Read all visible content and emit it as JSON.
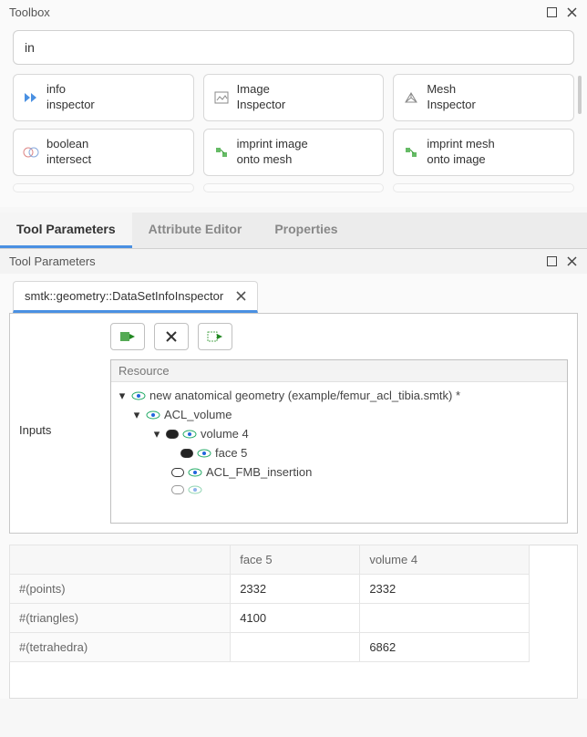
{
  "toolbox": {
    "title": "Toolbox",
    "search_value": "in",
    "items": [
      {
        "icon": "fast-forward",
        "line1": "info",
        "line2": "inspector"
      },
      {
        "icon": "image",
        "line1": "Image",
        "line2": "Inspector"
      },
      {
        "icon": "mesh",
        "line1": "Mesh",
        "line2": "Inspector"
      },
      {
        "icon": "bool",
        "line1": "boolean",
        "line2": "intersect"
      },
      {
        "icon": "imprint",
        "line1": "imprint image",
        "line2": "onto mesh"
      },
      {
        "icon": "imprint",
        "line1": "imprint mesh",
        "line2": "onto image"
      }
    ]
  },
  "tabs": {
    "items": [
      "Tool Parameters",
      "Attribute Editor",
      "Properties"
    ],
    "active": 0
  },
  "params": {
    "title": "Tool Parameters",
    "subtab": "smtk::geometry::DataSetInfoInspector",
    "inputs_label": "Inputs",
    "tree_header": "Resource",
    "tree": {
      "root": "new anatomical geometry (example/femur_acl_tibia.smtk) *",
      "l1": "ACL_volume",
      "l2a": "volume 4",
      "l3a": "face 5",
      "l2b": "ACL_FMB_insertion"
    }
  },
  "stats": {
    "cols": [
      "",
      "face 5",
      "volume 4"
    ],
    "rows": [
      {
        "label": "#(points)",
        "c1": "2332",
        "c2": "2332"
      },
      {
        "label": "#(triangles)",
        "c1": "4100",
        "c2": ""
      },
      {
        "label": "#(tetrahedra)",
        "c1": "",
        "c2": "6862"
      }
    ]
  }
}
